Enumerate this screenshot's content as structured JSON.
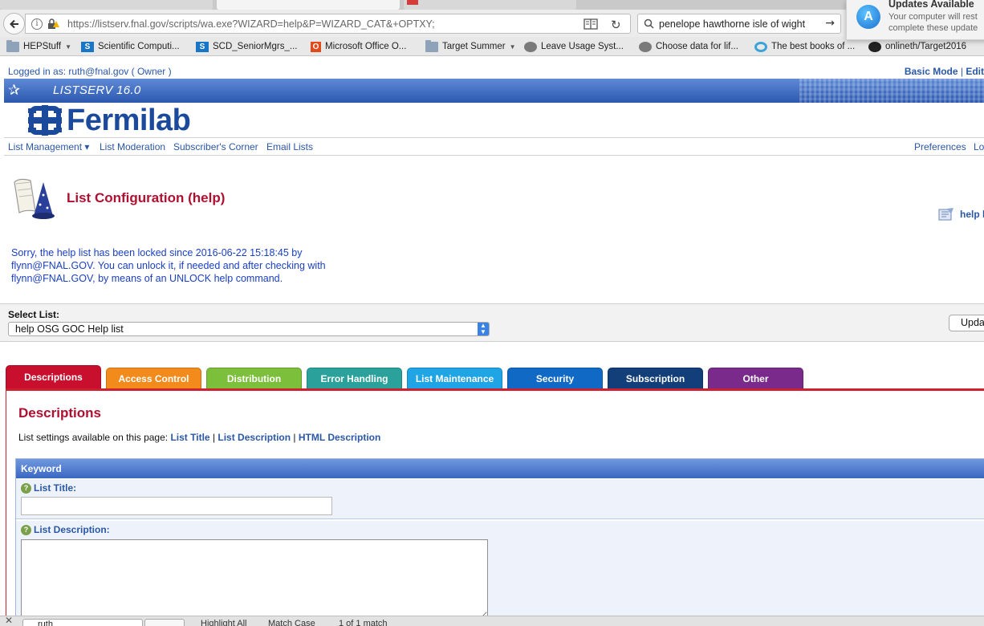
{
  "browser": {
    "url": "https://listserv.fnal.gov/scripts/wa.exe?WIZARD=help&P=WIZARD_CAT&+OPTXY;",
    "search_text": "penelope hawthorne isle of wight",
    "bookmarks": [
      {
        "label": "HEPStuff",
        "icon": "folder-icon",
        "dropdown": true
      },
      {
        "label": "Scientific Computi...",
        "icon": "sharepoint-icon"
      },
      {
        "label": "SCD_SeniorMgrs_...",
        "icon": "sharepoint-icon"
      },
      {
        "label": "Microsoft Office O...",
        "icon": "office-icon"
      },
      {
        "label": "Target Summer",
        "icon": "folder-icon",
        "dropdown": true
      },
      {
        "label": "Leave Usage Syst...",
        "icon": "globe-icon"
      },
      {
        "label": "Choose data for lif...",
        "icon": "globe-icon"
      },
      {
        "label": "The best books of ...",
        "icon": "ring-icon"
      },
      {
        "label": "onlineth/Target2016",
        "icon": "github-icon"
      }
    ],
    "notification": {
      "title": "Updates Available",
      "line1": "Your computer will rest",
      "line2": "complete these update"
    },
    "findbar": {
      "query": "ruth",
      "highlight_all": "Highlight All",
      "match_case": "Match Case",
      "matches": "1 of 1 match"
    }
  },
  "page": {
    "logged_in": "Logged in as: ruth@fnal.gov ( Owner )",
    "basic_mode": "Basic Mode",
    "edit": "Edit",
    "banner_title": "LISTSERV 16.0",
    "logo_text": "Fermilab",
    "nav": {
      "list_management": "List Management ▾",
      "list_moderation": "List Moderation",
      "subscribers_corner": "Subscriber's Corner",
      "email_lists": "Email Lists",
      "preferences": "Preferences",
      "logout": "Lo"
    },
    "title": "List Configuration (help)",
    "help_doc": "help l",
    "lock_message": "Sorry, the help list has been locked since 2016-06-22 15:18:45 by flynn@FNAL.GOV. You can unlock it, if needed and after checking with flynn@FNAL.GOV, by means of an UNLOCK help command.",
    "select_list_label": "Select List:",
    "select_list_value": "help OSG GOC Help list",
    "update_button": "Upda",
    "tabs": [
      {
        "label": "Descriptions",
        "color": "#c8102e"
      },
      {
        "label": "Access Control",
        "color": "#f28b1c"
      },
      {
        "label": "Distribution",
        "color": "#7cbf3a"
      },
      {
        "label": "Error Handling",
        "color": "#2aa19b"
      },
      {
        "label": "List Maintenance",
        "color": "#1fa4e6"
      },
      {
        "label": "Security",
        "color": "#1069c4"
      },
      {
        "label": "Subscription",
        "color": "#123f7a"
      },
      {
        "label": "Other",
        "color": "#7a2a8a"
      }
    ],
    "section_heading": "Descriptions",
    "available_prefix": "List settings available on this page:",
    "available_links": [
      "List Title",
      "List Description",
      "HTML Description"
    ],
    "keyword_header": "Keyword",
    "fields": {
      "list_title_label": "List Title:",
      "list_title_value": "",
      "list_description_label": "List Description:",
      "list_description_value": ""
    }
  }
}
